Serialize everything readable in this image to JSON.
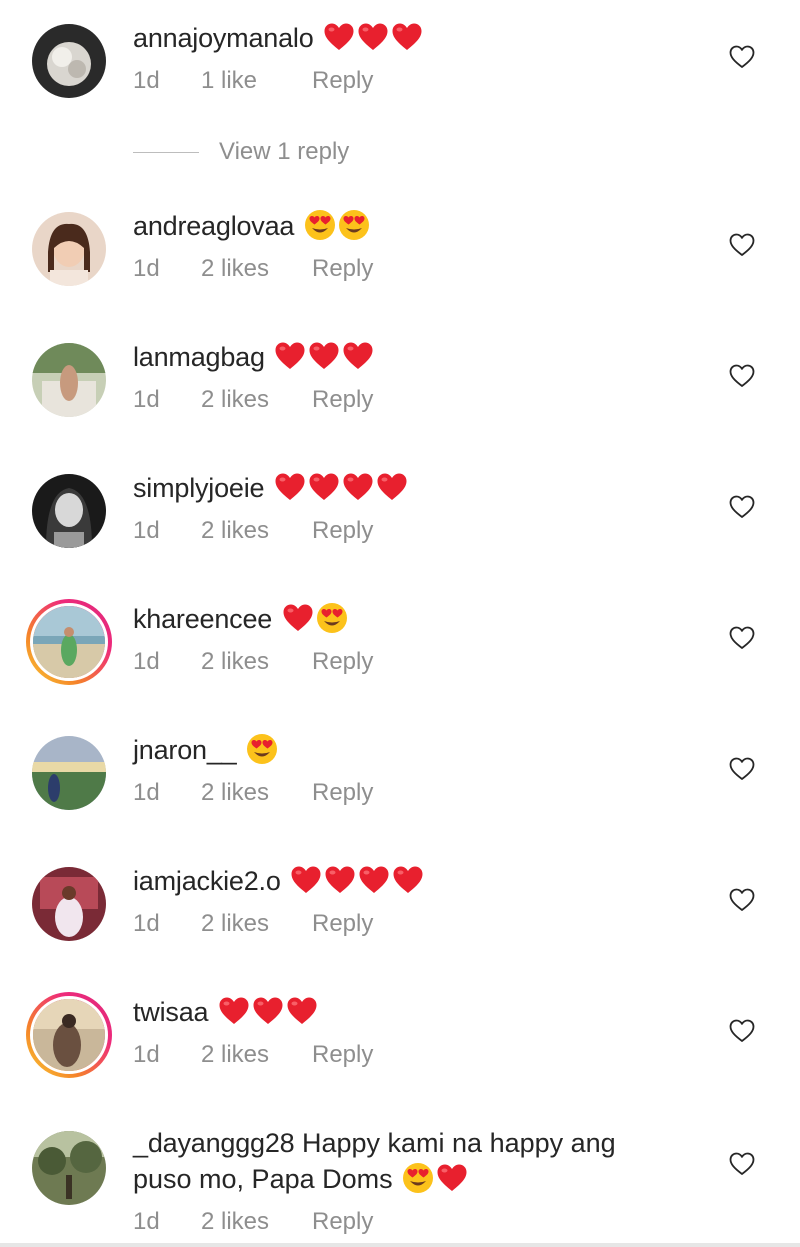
{
  "comments": [
    {
      "username": "annajoymanalo",
      "emojis": [
        "heart",
        "heart",
        "heart"
      ],
      "time": "1d",
      "likes": "1 like",
      "reply": "Reply"
    },
    {
      "username": "andreaglovaa",
      "emojis": [
        "heart-eyes",
        "heart-eyes"
      ],
      "time": "1d",
      "likes": "2 likes",
      "reply": "Reply"
    },
    {
      "username": "lanmagbag",
      "emojis": [
        "heart",
        "heart",
        "heart"
      ],
      "time": "1d",
      "likes": "2 likes",
      "reply": "Reply"
    },
    {
      "username": "simplyjoeie",
      "emojis": [
        "heart",
        "heart",
        "heart",
        "heart"
      ],
      "time": "1d",
      "likes": "2 likes",
      "reply": "Reply"
    },
    {
      "username": "khareencee",
      "emojis": [
        "heart",
        "heart-eyes"
      ],
      "time": "1d",
      "likes": "2 likes",
      "reply": "Reply"
    },
    {
      "username": "jnaron__",
      "emojis": [
        "heart-eyes"
      ],
      "time": "1d",
      "likes": "2 likes",
      "reply": "Reply"
    },
    {
      "username": "iamjackie2.o",
      "emojis": [
        "heart",
        "heart",
        "heart",
        "heart"
      ],
      "time": "1d",
      "likes": "2 likes",
      "reply": "Reply"
    },
    {
      "username": "twisaa",
      "emojis": [
        "heart",
        "heart",
        "heart"
      ],
      "time": "1d",
      "likes": "2 likes",
      "reply": "Reply"
    },
    {
      "username": "_dayanggg28",
      "text_part1": "Happy kami na happy ang",
      "text_part2": "puso mo, Papa Doms",
      "emojis": [
        "heart-eyes",
        "heart"
      ],
      "time": "1d",
      "likes": "2 likes",
      "reply": "Reply"
    }
  ],
  "view_replies": "View 1 reply",
  "icons": {
    "like": "heart-outline-icon"
  },
  "colors": {
    "username": "#262626",
    "meta": "#8e8e8e",
    "heart_emoji": "#e8202e",
    "story_ring": "#ee2a7b"
  }
}
